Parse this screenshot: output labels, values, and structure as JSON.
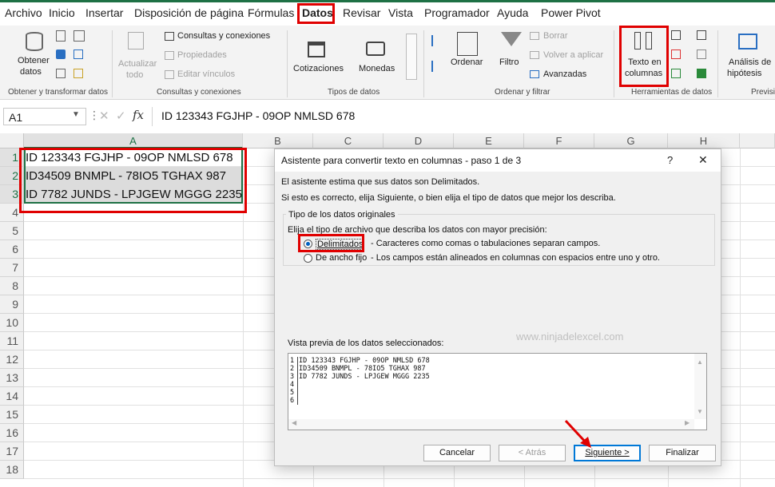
{
  "menu": {
    "items": [
      "Archivo",
      "Inicio",
      "Insertar",
      "Disposición de página",
      "Fórmulas",
      "Datos",
      "Revisar",
      "Vista",
      "Programador",
      "Ayuda",
      "Power Pivot"
    ],
    "active": "Datos"
  },
  "ribbon": {
    "get_data": "Obtener",
    "get_data2": "datos",
    "refresh": "Actualizar",
    "refresh2": "todo",
    "queries": "Consultas y conexiones",
    "properties": "Propiedades",
    "edit_links": "Editar vínculos",
    "stocks": "Cotizaciones",
    "currencies": "Monedas",
    "sort": "Ordenar",
    "filter": "Filtro",
    "clear": "Borrar",
    "reapply": "Volver a aplicar",
    "advanced": "Avanzadas",
    "text_to_columns": "Texto en",
    "text_to_columns2": "columnas",
    "whatif": "Análisis de",
    "whatif2": "hipótesis",
    "groups": {
      "get_transform": "Obtener y transformar datos",
      "queries": "Consultas y conexiones",
      "data_types": "Tipos de datos",
      "sort_filter": "Ordenar y filtrar",
      "data_tools": "Herramientas de datos",
      "forecast": "Previsi"
    }
  },
  "formula_bar": {
    "name_box": "A1",
    "fx": "fx",
    "content": "ID 123343 FGJHP - 09OP NMLSD 678"
  },
  "grid": {
    "columns": [
      "A",
      "B",
      "C",
      "D",
      "E",
      "F",
      "G",
      "H"
    ],
    "rows": [
      "1",
      "2",
      "3",
      "4",
      "5",
      "6",
      "7",
      "8",
      "9",
      "10",
      "11",
      "12",
      "13",
      "14",
      "15",
      "16",
      "17",
      "18"
    ],
    "cells": [
      "ID 123343 FGJHP - 09OP NMLSD 678",
      "ID34509 BNMPL - 78IO5 TGHAX 987",
      "ID 7782 JUNDS - LPJGEW MGGG 2235"
    ]
  },
  "dialog": {
    "title": "Asistente para convertir texto en columnas - paso 1 de 3",
    "help": "?",
    "close": "✕",
    "line1": "El asistente estima que sus datos son Delimitados.",
    "line2": "Si esto es correcto, elija Siguiente, o bien elija el tipo de datos que mejor los describa.",
    "group_title": "Tipo de los datos originales",
    "choose": "Elija el tipo de archivo que describa los datos con mayor precisión:",
    "opt_delimited": "Delimitados",
    "opt_delimited_desc": "- Caracteres como comas o tabulaciones separan campos.",
    "opt_fixed": "De ancho fijo",
    "opt_fixed_desc": "- Los campos están alineados en columnas con espacios entre uno y otro.",
    "watermark": "www.ninjadelexcel.com",
    "preview_label": "Vista previa de los datos seleccionados:",
    "preview_lines": [
      {
        "n": "1",
        "t": "ID 123343 FGJHP - 09OP NMLSD 678"
      },
      {
        "n": "2",
        "t": "ID34509 BNMPL - 78IO5 TGHAX 987"
      },
      {
        "n": "3",
        "t": "ID 7782 JUNDS - LPJGEW MGGG 2235"
      },
      {
        "n": "4",
        "t": ""
      },
      {
        "n": "5",
        "t": ""
      },
      {
        "n": "6",
        "t": ""
      }
    ],
    "btn_cancel": "Cancelar",
    "btn_back": "< Atrás",
    "btn_next": "Siguiente >",
    "btn_finish": "Finalizar"
  }
}
